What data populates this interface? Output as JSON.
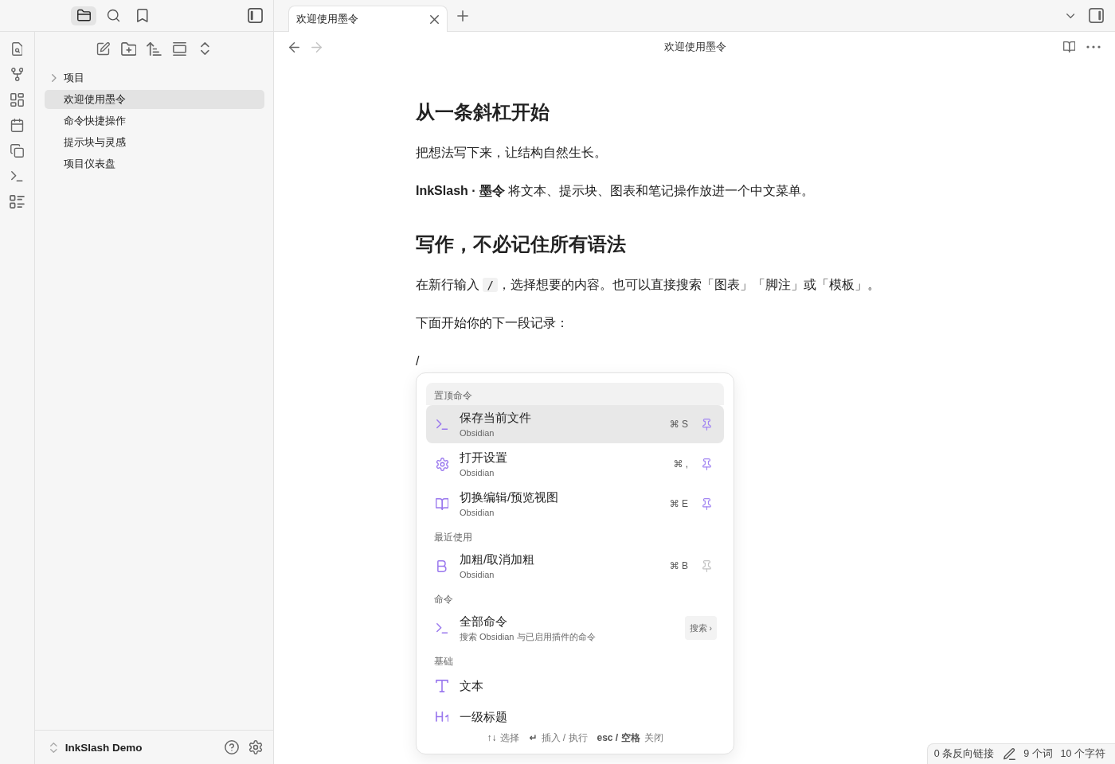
{
  "sidebar_tabs": [
    {
      "selected": true
    },
    {
      "selected": false
    },
    {
      "selected": false
    }
  ],
  "file_tree": [
    {
      "kind": "folder",
      "label": "项目",
      "expanded": false,
      "selected": false
    },
    {
      "kind": "file",
      "label": "欢迎使用墨令",
      "selected": true
    },
    {
      "kind": "file",
      "label": "命令快捷操作",
      "selected": false
    },
    {
      "kind": "file",
      "label": "提示块与灵感",
      "selected": false
    },
    {
      "kind": "file",
      "label": "项目仪表盘",
      "selected": false
    }
  ],
  "vault": {
    "name": "InkSlash Demo"
  },
  "tabs": [
    {
      "title": "欢迎使用墨令",
      "selected": true
    }
  ],
  "nav": {
    "back": {
      "disabled": false
    },
    "forward": {
      "disabled": true
    },
    "title": "欢迎使用墨令"
  },
  "document": {
    "blocks": [
      {
        "kind": "heading",
        "text": "从一条斜杠开始"
      },
      {
        "kind": "paragraph",
        "text": "把想法写下来，让结构自然生长。"
      },
      {
        "kind": "paragraph",
        "text": "**InkSlash · 墨令** 将文本、提示块、图表和笔记操作放进一个中文菜单。"
      },
      {
        "kind": "heading",
        "text": "写作，不必记住所有语法"
      },
      {
        "kind": "segmented",
        "segments": [
          {
            "kind": "text",
            "text": "在新行输入 "
          },
          {
            "kind": "code",
            "text": "/"
          },
          {
            "kind": "text",
            "text": "，选择想要的内容。也可以直接搜索「图表」「脚注」或「模板」。"
          }
        ]
      },
      {
        "kind": "paragraph",
        "text": "下面开始你的下一段记录："
      },
      {
        "kind": "slash_line",
        "text": "/"
      }
    ]
  },
  "slash_menu": {
    "sections": [
      {
        "title": "置顶命令",
        "items": [
          {
            "kind": "command",
            "title": "保存当前文件",
            "subtitle": "Obsidian",
            "shortcut": "⌘ S",
            "pinned": true,
            "selected": true
          },
          {
            "kind": "command",
            "title": "打开设置",
            "subtitle": "Obsidian",
            "shortcut": "⌘ ,",
            "pinned": true,
            "selected": false
          },
          {
            "kind": "command",
            "title": "切换编辑/预览视图",
            "subtitle": "Obsidian",
            "shortcut": "⌘ E",
            "pinned": true,
            "selected": false
          }
        ]
      },
      {
        "title": "最近使用",
        "items": [
          {
            "kind": "command",
            "title": "加粗/取消加粗",
            "subtitle": "Obsidian",
            "shortcut": "⌘ B",
            "pinned": false,
            "selected": false
          }
        ]
      },
      {
        "title": "命令",
        "items": [
          {
            "kind": "link",
            "title": "全部命令",
            "subtitle": "搜索 Obsidian 与已启用插件的命令",
            "badge": "搜索 ›",
            "selected": false
          }
        ]
      },
      {
        "title": "基础",
        "items": [
          {
            "kind": "block",
            "title": "文本",
            "selected": false
          },
          {
            "kind": "block",
            "title": "一级标题",
            "selected": false
          }
        ]
      }
    ],
    "footer": [
      {
        "keys": "↑↓",
        "label": "选择"
      },
      {
        "keys": "↵",
        "label": "插入 / 执行"
      },
      {
        "keys": "esc / 空格",
        "label": "关闭"
      }
    ]
  },
  "status_bar": {
    "backlinks": "0 条反向链接",
    "words": "9 个词",
    "characters": "10 个字符"
  }
}
